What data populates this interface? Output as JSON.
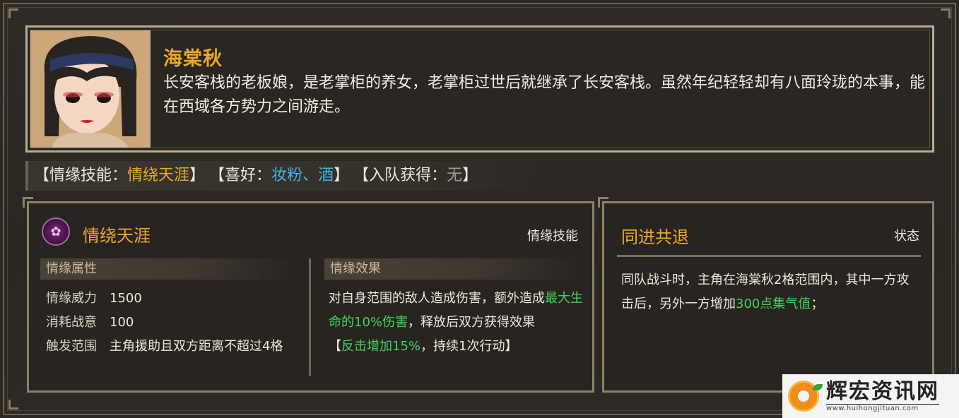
{
  "character": {
    "name": "海棠秋",
    "description": "长安客栈的老板娘，是老掌柜的养女，老掌柜过世后就继承了长安客栈。虽然年纪轻轻却有八面玲珑的本事，能在西域各方势力之间游走。"
  },
  "tags": {
    "skill_label": "【情缘技能：",
    "skill_value": "情绕天涯",
    "skill_close": "】",
    "like_label": "【喜好：",
    "like_value": "妆粉、酒",
    "like_close": "】",
    "join_label": "【入队获得：",
    "join_value": "无",
    "join_close": "】"
  },
  "skill": {
    "title": "情绕天涯",
    "type": "情缘技能",
    "attr_header": "情缘属性",
    "effect_header": "情缘效果",
    "attrs": [
      {
        "key": "情缘威力",
        "value": "1500"
      },
      {
        "key": "消耗战意",
        "value": "100"
      },
      {
        "key": "触发范围",
        "value": "主角援助且双方距离不超过4格"
      }
    ],
    "effect": {
      "part1": "对自身范围的敌人造成伤害，额外造成",
      "part2": "最大生命的10%伤害",
      "part3": "，释放后双方获得效果",
      "part4": "【",
      "part5": "反击增加15%",
      "part6": "，持续1次行动】"
    }
  },
  "status": {
    "title": "同进共退",
    "type": "状态",
    "text1": "同队战斗时，主角在海棠秋2格范围内，其中一方攻击后，另外一方增加",
    "text2": "300点集气值",
    "text3": "；"
  },
  "watermark": {
    "title": "辉宏资讯网",
    "url": "www.huihongjituan.com"
  },
  "colors": {
    "gold": "#e8a828",
    "blue": "#3fb3e6",
    "green": "#3fd35a",
    "frame": "#b9ab8e"
  },
  "icons": {
    "skill": "lotus-icon",
    "portrait": "character-portrait"
  }
}
